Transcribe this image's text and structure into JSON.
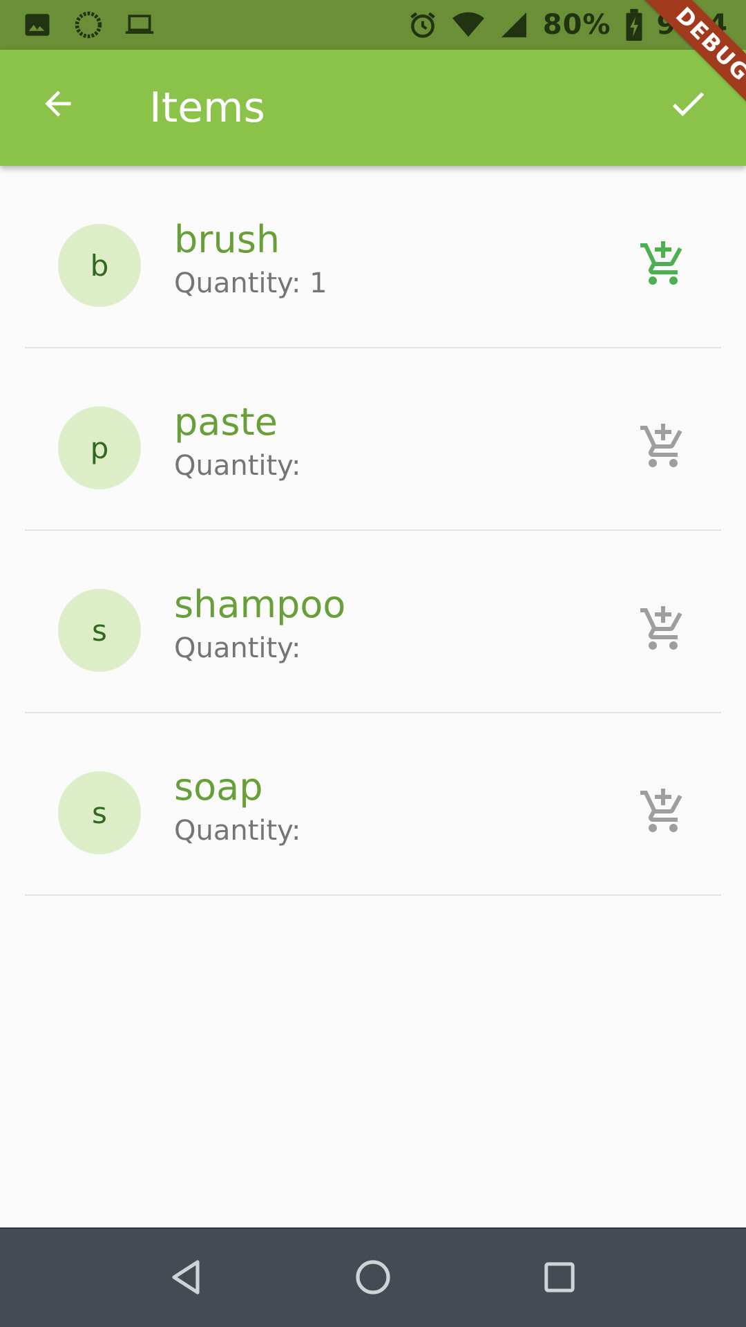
{
  "status_bar": {
    "battery_percent": "80%",
    "time": "9:54",
    "icons": [
      "image-icon",
      "sync-icon",
      "laptop-icon",
      "alarm-icon",
      "wifi-icon",
      "signal-icon",
      "battery-charging-icon"
    ]
  },
  "app_bar": {
    "title": "Items",
    "back_icon": "arrow-back-icon",
    "confirm_icon": "check-icon"
  },
  "debug_banner": {
    "label": "DEBUG"
  },
  "items": [
    {
      "initial": "b",
      "name": "brush",
      "quantity": "Quantity: 1",
      "in_cart": true
    },
    {
      "initial": "p",
      "name": "paste",
      "quantity": "Quantity:",
      "in_cart": false
    },
    {
      "initial": "s",
      "name": "shampoo",
      "quantity": "Quantity:",
      "in_cart": false
    },
    {
      "initial": "s",
      "name": "soap",
      "quantity": "Quantity:",
      "in_cart": false
    }
  ],
  "nav_bar": {
    "icons": [
      "nav-back-icon",
      "nav-home-icon",
      "nav-recents-icon"
    ]
  },
  "colors": {
    "primary": "#8bc34a",
    "primary_dark": "#6a8f37",
    "item_title": "#689f38",
    "avatar_bg": "#dcedc8",
    "cart_active": "#4caf50",
    "cart_inactive": "#9e9e9e"
  }
}
